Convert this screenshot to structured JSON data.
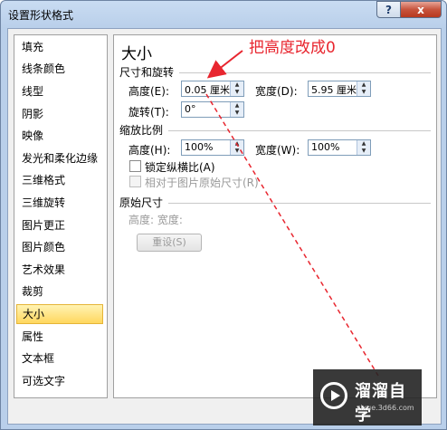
{
  "window": {
    "title": "设置形状格式",
    "help_label": "?",
    "close_label": "x"
  },
  "nav": {
    "items": [
      "填充",
      "线条颜色",
      "线型",
      "阴影",
      "映像",
      "发光和柔化边缘",
      "三维格式",
      "三维旋转",
      "图片更正",
      "图片颜色",
      "艺术效果",
      "裁剪",
      "大小",
      "属性",
      "文本框",
      "可选文字"
    ],
    "selected": "大小"
  },
  "panel": {
    "heading": "大小",
    "size_rotate": {
      "section_label": "尺寸和旋转",
      "height_label": "高度(E):",
      "height_value": "0.05 厘米",
      "width_label": "宽度(D):",
      "width_value": "5.95 厘米",
      "rotate_label": "旋转(T):",
      "rotate_value": "0°"
    },
    "scale": {
      "section_label": "缩放比例",
      "height_label": "高度(H):",
      "height_value": "100%",
      "width_label": "宽度(W):",
      "width_value": "100%",
      "lock_ratio_label": "锁定纵横比(A)",
      "relative_label": "相对于图片原始尺寸(R)"
    },
    "original": {
      "section_label": "原始尺寸",
      "height_width_label": "高度:  宽度:",
      "reset_button": "重设(S)"
    }
  },
  "annotation": {
    "text": "把高度改成0",
    "color": "#e8262f"
  },
  "watermark": {
    "title": "溜溜自学",
    "url": "zixue.3d66.com"
  }
}
